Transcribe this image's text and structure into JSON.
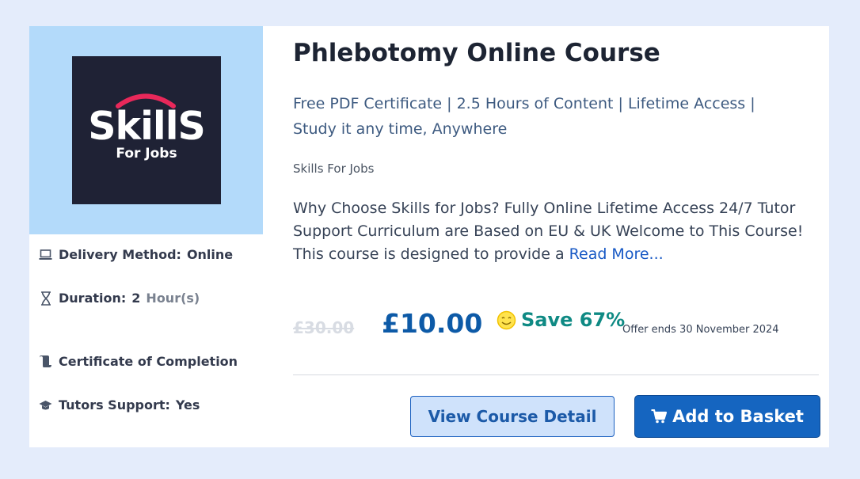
{
  "logo": {
    "word": "SkillS",
    "sub": "For Jobs"
  },
  "meta": {
    "delivery_label": "Delivery Method:",
    "delivery_value": "Online",
    "duration_label": "Duration:",
    "duration_value": "2",
    "duration_unit": "Hour(s)",
    "certificate_label": "Certificate of Completion",
    "tutor_label": "Tutors Support:",
    "tutor_value": "Yes"
  },
  "course": {
    "title": "Phlebotomy Online Course",
    "subtitle": "Free PDF Certificate | 2.5 Hours of Content | Lifetime Access | Study it any time, Anywhere",
    "provider": "Skills For Jobs",
    "description": "Why Choose Skills for Jobs? Fully Online  Lifetime Access 24/7 Tutor Support Curriculum are Based on EU & UK  Welcome to This Course! This course is designed to provide a ",
    "read_more": "Read More..."
  },
  "pricing": {
    "old_price": "£30.00",
    "price": "£10.00",
    "save": "Save 67%",
    "offer_ends": "Offer ends 30 November 2024"
  },
  "buttons": {
    "view_detail": "View Course Detail",
    "add_basket": "Add to Basket"
  },
  "colors": {
    "page_bg": "#e4ecfb",
    "thumb_bg": "#b3dafa",
    "logo_bg": "#1f2235",
    "logo_arc": "#e8285a",
    "price": "#0d5aa7",
    "save": "#0f8a84",
    "primary_button": "#1565c0"
  },
  "icons": [
    "laptop-icon",
    "hourglass-icon",
    "certificate-icon",
    "graduation-cap-icon",
    "smile-icon",
    "cart-icon"
  ]
}
